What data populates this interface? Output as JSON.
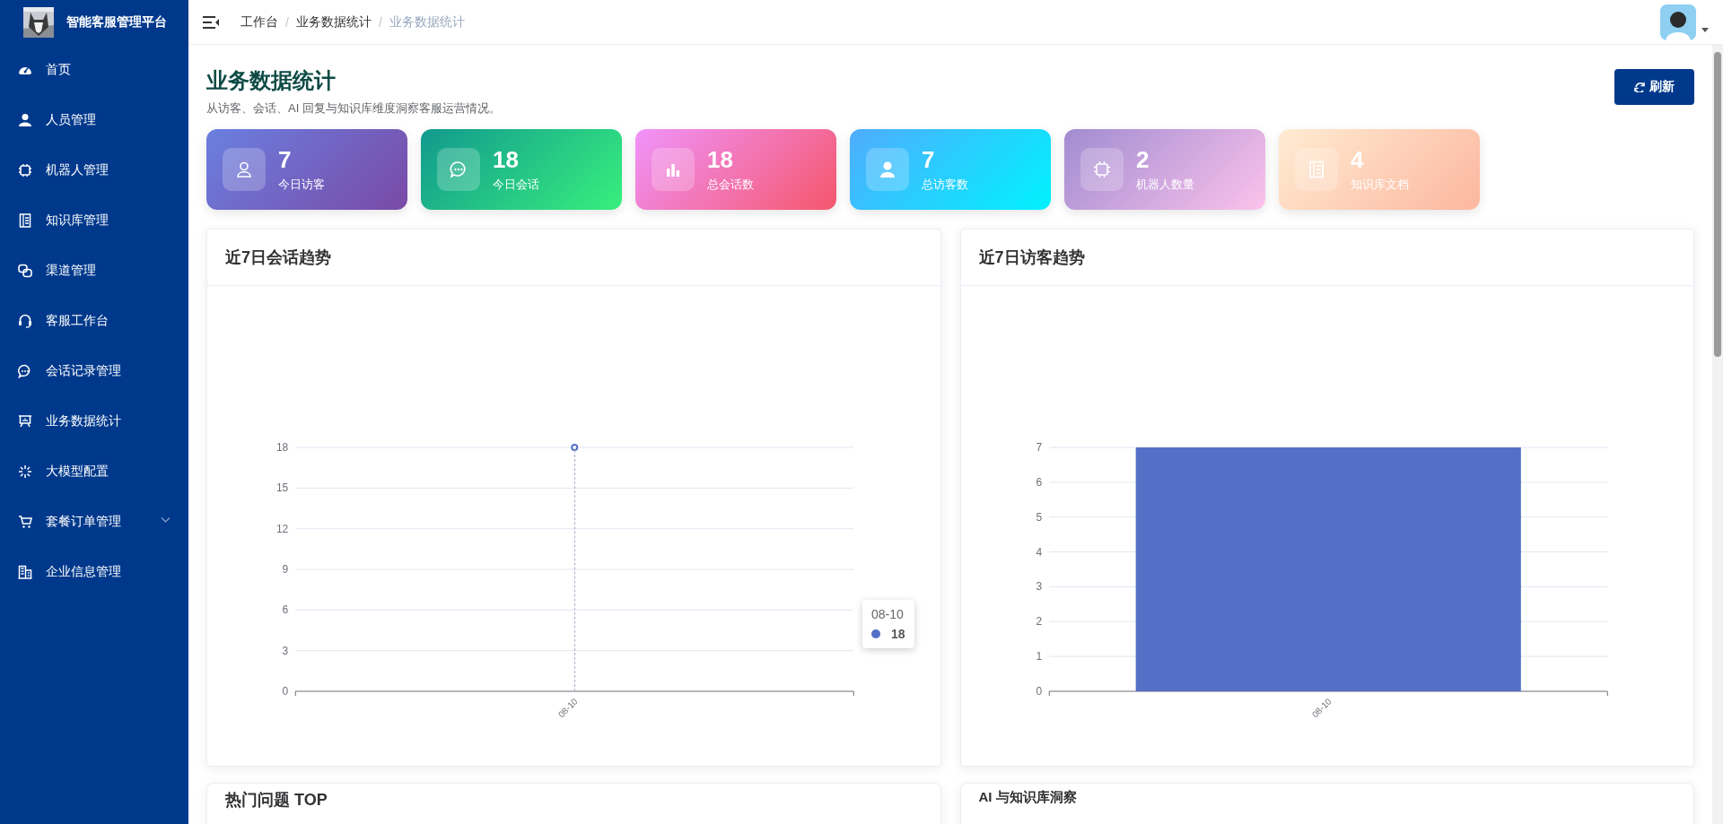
{
  "sidebar": {
    "logo_text": "智能客服管理平台",
    "items": [
      {
        "label": "首页",
        "selected": false,
        "kind": "link"
      },
      {
        "label": "人员管理",
        "selected": false,
        "kind": "link"
      },
      {
        "label": "机器人管理",
        "selected": false,
        "kind": "link"
      },
      {
        "label": "知识库管理",
        "selected": false,
        "kind": "link"
      },
      {
        "label": "渠道管理",
        "selected": false,
        "kind": "link"
      },
      {
        "label": "客服工作台",
        "selected": false,
        "kind": "link"
      },
      {
        "label": "会话记录管理",
        "selected": false,
        "kind": "link"
      },
      {
        "label": "业务数据统计",
        "selected": false,
        "kind": "link"
      },
      {
        "label": "大模型配置",
        "selected": false,
        "kind": "link"
      },
      {
        "label": "套餐订单管理",
        "selected": false,
        "kind": "group"
      },
      {
        "label": "企业信息管理",
        "selected": false,
        "kind": "link"
      }
    ]
  },
  "header": {
    "separator": "/",
    "breadcrumb": [
      {
        "label": "工作台",
        "selected": false
      },
      {
        "label": "业务数据统计",
        "selected": false
      },
      {
        "label": "业务数据统计",
        "selected": true
      }
    ]
  },
  "page": {
    "title": "业务数据统计",
    "subtitle": "从访客、会话、AI 回复与知识库维度洞察客服运营情况。",
    "refresh_button": "刷新"
  },
  "stats": [
    {
      "value": "7",
      "label": "今日访客"
    },
    {
      "value": "18",
      "label": "今日会话"
    },
    {
      "value": "18",
      "label": "总会话数"
    },
    {
      "value": "7",
      "label": "总访客数"
    },
    {
      "value": "2",
      "label": "机器人数量"
    },
    {
      "value": "4",
      "label": "知识库文档"
    }
  ],
  "charts": [
    {
      "tooltip": {
        "label": "08-10",
        "value": "18",
        "color": "#5470c6"
      },
      "chart_data": {
        "type": "line",
        "title": "近7日会话趋势",
        "categories": [
          "08-10"
        ],
        "series": [
          {
            "color": "#5470c6",
            "marker": "circle",
            "values": [
              18
            ]
          }
        ],
        "ylim": [
          0,
          18
        ],
        "yticks": [
          0,
          3,
          6,
          9,
          12,
          15,
          18
        ],
        "grid": true
      }
    },
    {
      "chart_data": {
        "type": "bar",
        "title": "近7日访客趋势",
        "categories": [
          "08-10"
        ],
        "series": [
          {
            "color": "#5470c6",
            "values": [
              7
            ]
          }
        ],
        "ylim": [
          0,
          7
        ],
        "yticks": [
          0,
          1,
          2,
          3,
          4,
          5,
          6,
          7
        ],
        "grid": true
      }
    }
  ],
  "panels": [
    {
      "title": "热门问题 TOP"
    },
    {
      "title": "AI 与知识库洞察"
    }
  ]
}
